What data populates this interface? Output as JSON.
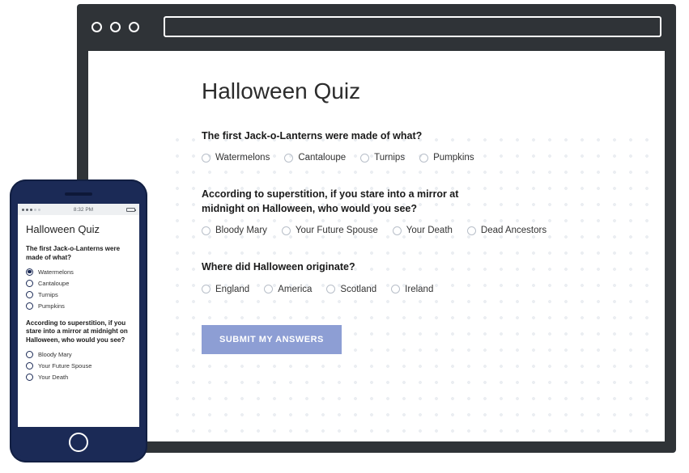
{
  "desktop": {
    "title": "Halloween Quiz",
    "questions": [
      {
        "text": "The first Jack-o-Lanterns were made of what?",
        "options": [
          "Watermelons",
          "Cantaloupe",
          "Turnips",
          "Pumpkins"
        ]
      },
      {
        "text": "According to superstition, if you stare into a mirror at midnight on Halloween, who would you see?",
        "options": [
          "Bloody Mary",
          "Your Future Spouse",
          "Your Death",
          "Dead Ancestors"
        ]
      },
      {
        "text": "Where did Halloween originate?",
        "options": [
          "England",
          "America",
          "Scotland",
          "Ireland"
        ]
      }
    ],
    "submit_label": "SUBMIT MY ANSWERS"
  },
  "phone": {
    "status": {
      "time": "8:32 PM"
    },
    "title": "Halloween Quiz",
    "questions": [
      {
        "text": "The first Jack-o-Lanterns were made of what?",
        "options": [
          "Watermelons",
          "Cantaloupe",
          "Turnips",
          "Pumpkins"
        ],
        "selected": 0
      },
      {
        "text": "According to superstition, if you stare into a mirror at midnight on Halloween, who would you see?",
        "options": [
          "Bloody Mary",
          "Your Future Spouse",
          "Your Death"
        ],
        "selected": -1
      }
    ]
  }
}
